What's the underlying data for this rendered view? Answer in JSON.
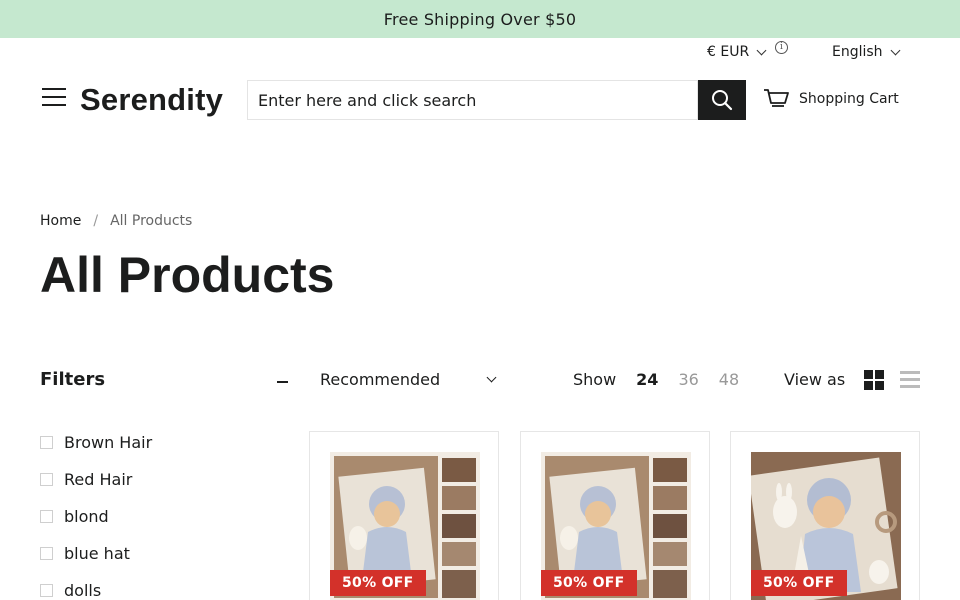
{
  "announcement": "Free Shipping Over $50",
  "currency": "€ EUR",
  "language": "English",
  "brand": "Serendity",
  "search": {
    "placeholder": "Enter here and click search"
  },
  "cart_label": "Shopping Cart",
  "breadcrumb": {
    "home": "Home",
    "separator": "/",
    "current": "All Products"
  },
  "page_title": "All Products",
  "filters": {
    "title": "Filters",
    "items": [
      "Brown Hair",
      "Red Hair",
      "blond",
      "blue hat",
      "dolls"
    ]
  },
  "sort": {
    "selected": "Recommended"
  },
  "show": {
    "label": "Show",
    "options": [
      "24",
      "36",
      "48"
    ],
    "active": "24"
  },
  "view_as": "View as",
  "products": [
    {
      "badge": "50% OFF"
    },
    {
      "badge": "50% OFF"
    },
    {
      "badge": "50% OFF"
    }
  ],
  "colors": {
    "announcement_bg": "#c5e8cf",
    "accent": "#1c1d1d",
    "sale_badge": "#d3312a"
  }
}
